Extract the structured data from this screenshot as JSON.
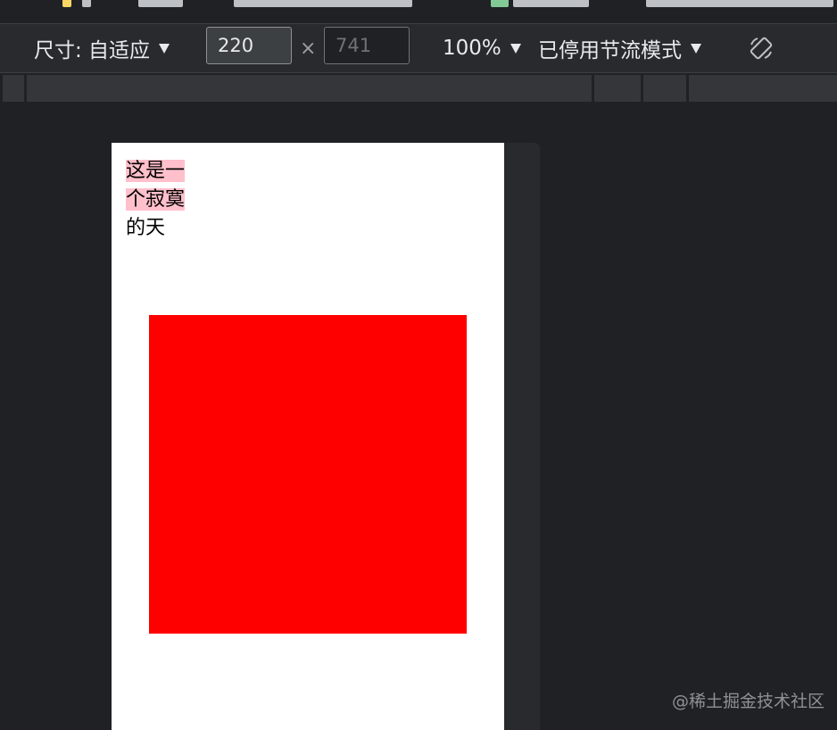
{
  "toolbar": {
    "size_label": "尺寸: 自适应",
    "width_value": "220",
    "height_placeholder": "741",
    "times_symbol": "×",
    "zoom_label": "100%",
    "throttle_label": "已停用节流模式",
    "rotate_icon": "rotate-icon"
  },
  "page": {
    "text_highlighted": "这是一个寂寞",
    "text_rest": "的天",
    "box_color": "#ff0000",
    "highlight_color": "#ffc0cb"
  },
  "watermark": "@稀土掘金技术社区"
}
